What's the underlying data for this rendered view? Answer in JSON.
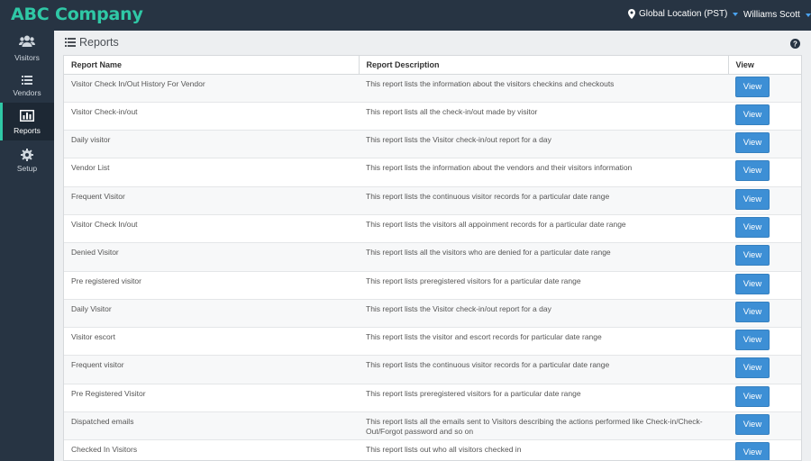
{
  "app": {
    "brand": "ABC Company"
  },
  "topbar": {
    "location": "Global Location (PST)",
    "user": "Williams Scott"
  },
  "sidebar": {
    "items": [
      {
        "label": "Visitors",
        "icon": "users-icon"
      },
      {
        "label": "Vendors",
        "icon": "list-icon"
      },
      {
        "label": "Reports",
        "icon": "bar-chart-icon",
        "active": true
      },
      {
        "label": "Setup",
        "icon": "gear-icon"
      }
    ]
  },
  "page": {
    "title": "Reports"
  },
  "table": {
    "columns": [
      "Report Name",
      "Report Description",
      "View"
    ],
    "view_label": "View",
    "rows": [
      {
        "name": "Visitor Check In/Out History For Vendor",
        "desc": "This report lists the information about the visitors checkins and checkouts"
      },
      {
        "name": "Visitor Check-in/out",
        "desc": "This report lists all the check-in/out made by visitor"
      },
      {
        "name": "Daily visitor",
        "desc": "This report lists the Visitor check-in/out report for a day"
      },
      {
        "name": "Vendor List",
        "desc": "This report lists the information about the vendors and their visitors information"
      },
      {
        "name": "Frequent Visitor",
        "desc": "This report lists the continuous visitor records for a particular date range"
      },
      {
        "name": "Visitor Check In/out",
        "desc": "This report lists the visitors all appoinment records for a particular date range"
      },
      {
        "name": "Denied Visitor",
        "desc": "This report lists all the visitors who are denied for a particular date range"
      },
      {
        "name": "Pre registered visitor",
        "desc": "This report lists preregistered visitors for a particular date range"
      },
      {
        "name": "Daily Visitor",
        "desc": "This report lists the Visitor check-in/out report for a day"
      },
      {
        "name": "Visitor escort",
        "desc": "This report lists the visitor and escort records for particular date range"
      },
      {
        "name": "Frequent visitor",
        "desc": "This report lists the continuous visitor records for a particular date range"
      },
      {
        "name": "Pre Registered Visitor",
        "desc": "This report lists preregistered visitors for a particular date range"
      },
      {
        "name": "Dispatched emails",
        "desc": "This report lists all the emails sent to Visitors describing the actions performed like Check-in/Check-Out/Forgot password and so on"
      },
      {
        "name": "Checked In Visitors",
        "desc": "This report lists out who all visitors checked in"
      }
    ]
  }
}
